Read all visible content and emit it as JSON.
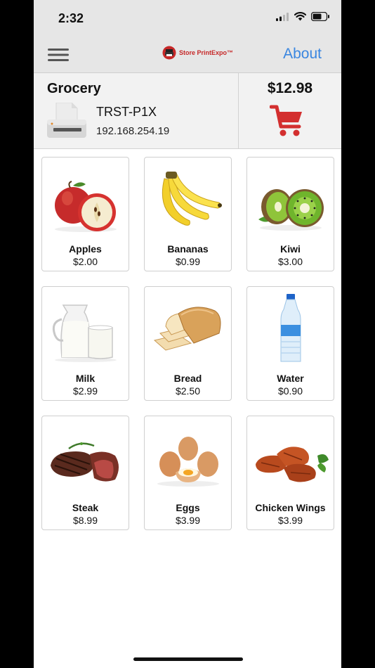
{
  "status_bar": {
    "time": "2:32"
  },
  "nav": {
    "brand_name": "Store PrintExpo™",
    "about_label": "About"
  },
  "header": {
    "store_name": "Grocery",
    "printer_name": "TRST-P1X",
    "printer_ip": "192.168.254.19",
    "cart_total": "$12.98"
  },
  "colors": {
    "accent_blue": "#3a86e0",
    "cart_red": "#d32f2f",
    "brand_red": "#c62828"
  },
  "products": [
    {
      "name": "Apples",
      "price": "$2.00",
      "icon": "apples-image"
    },
    {
      "name": "Bananas",
      "price": "$0.99",
      "icon": "bananas-image"
    },
    {
      "name": "Kiwi",
      "price": "$3.00",
      "icon": "kiwi-image"
    },
    {
      "name": "Milk",
      "price": "$2.99",
      "icon": "milk-image"
    },
    {
      "name": "Bread",
      "price": "$2.50",
      "icon": "bread-image"
    },
    {
      "name": "Water",
      "price": "$0.90",
      "icon": "water-bottle-image"
    },
    {
      "name": "Steak",
      "price": "$8.99",
      "icon": "steak-image"
    },
    {
      "name": "Eggs",
      "price": "$3.99",
      "icon": "eggs-image"
    },
    {
      "name": "Chicken Wings",
      "price": "$3.99",
      "icon": "chicken-wings-image"
    }
  ]
}
